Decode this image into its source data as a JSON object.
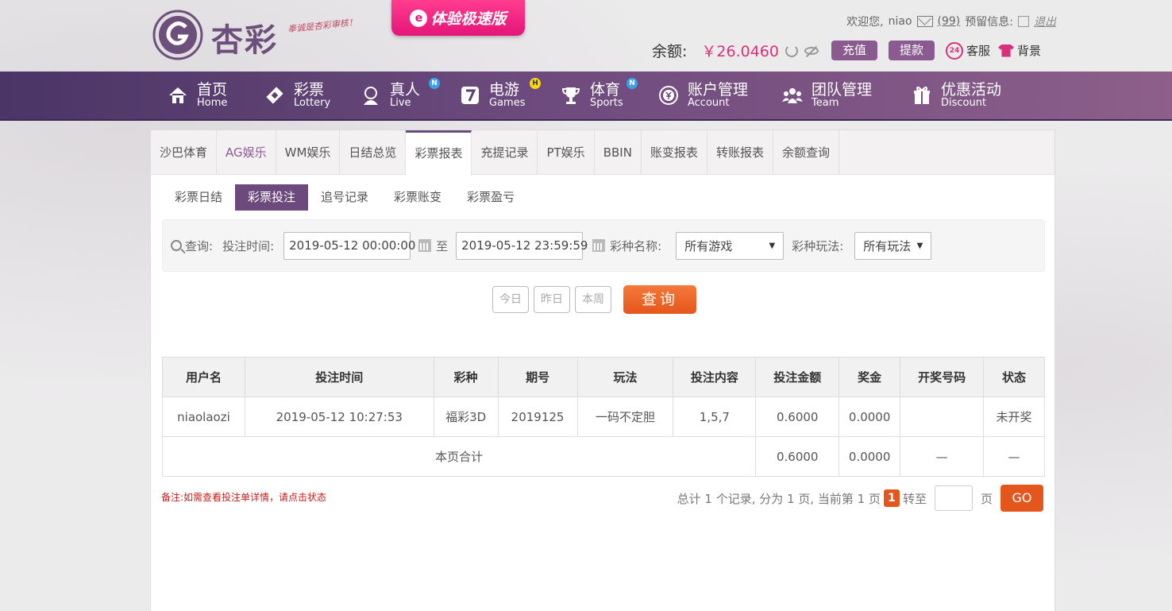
{
  "header": {
    "brand": "杏彩",
    "slogan": "奉诚是杏彩审核！",
    "speed_version": "体验极速版",
    "speed_icon": "e",
    "welcome_label": "欢迎您,",
    "username": "niao",
    "message_count": "(99)",
    "reserve_info": "预留信息:",
    "logout": "退出",
    "balance_label": "余额:",
    "balance_value": "￥26.0460",
    "deposit": "充值",
    "withdraw": "提款",
    "service": "客服",
    "service_icon_text": "24",
    "skin": "背景"
  },
  "nav": {
    "items": [
      {
        "cn": "首页",
        "en": "Home",
        "icon": "home-icon"
      },
      {
        "cn": "彩票",
        "en": "Lottery",
        "icon": "ticket-icon"
      },
      {
        "cn": "真人",
        "en": "Live",
        "icon": "dealer-icon",
        "badge": "N"
      },
      {
        "cn": "电游",
        "en": "Games",
        "icon": "slot-seven-icon",
        "badge": "H"
      },
      {
        "cn": "体育",
        "en": "Sports",
        "icon": "trophy-icon",
        "badge": "N"
      },
      {
        "cn": "账户管理",
        "en": "Account",
        "icon": "yen-coin-icon"
      },
      {
        "cn": "团队管理",
        "en": "Team",
        "icon": "team-icon"
      },
      {
        "cn": "优惠活动",
        "en": "Discount",
        "icon": "gift-icon"
      }
    ]
  },
  "tabs": [
    "沙巴体育",
    "AG娱乐",
    "WM娱乐",
    "日结总览",
    "彩票报表",
    "充提记录",
    "PT娱乐",
    "BBIN",
    "账变报表",
    "转账报表",
    "余额查询"
  ],
  "active_tab": "彩票报表",
  "subtabs": [
    "彩票日结",
    "彩票投注",
    "追号记录",
    "彩票账变",
    "彩票盈亏"
  ],
  "active_subtab": "彩票投注",
  "filter": {
    "query_label": "查询:",
    "bet_time_label": "投注时间:",
    "start_time": "2019-05-12 00:00:00",
    "to_label": "至",
    "end_time": "2019-05-12 23:59:59",
    "lottery_name_label": "彩种名称:",
    "lottery_name_value": "所有游戏",
    "play_label": "彩种玩法:",
    "play_value": "所有玩法"
  },
  "quick_buttons": {
    "today": "今日",
    "yesterday": "昨日",
    "this_week": "本周",
    "query": "查询"
  },
  "table": {
    "headers": [
      "用户名",
      "投注时间",
      "彩种",
      "期号",
      "玩法",
      "投注内容",
      "投注金额",
      "奖金",
      "开奖号码",
      "状态"
    ],
    "rows": [
      [
        "niaolaozi",
        "2019-05-12 10:27:53",
        "福彩3D",
        "2019125",
        "一码不定胆",
        "1,5,7",
        "0.6000",
        "0.0000",
        "",
        "未开奖"
      ]
    ],
    "subtotal_label": "本页合计",
    "subtotal_amount": "0.6000",
    "subtotal_bonus": "0.0000",
    "subtotal_draw": "—",
    "subtotal_status": "—"
  },
  "note": "备注:如需查看投注单详情，请点击状态",
  "pager": {
    "summary": "总计 1 个记录, 分为 1 页, 当前第 1 页",
    "current": "1",
    "goto_label": "转至",
    "page_label": "页",
    "go": "GO"
  },
  "colors": {
    "brand_purple": "#6d4a7d",
    "accent_orange": "#e5561c",
    "balance_pink": "#d8307a",
    "status_green": "#2a8a2a"
  }
}
